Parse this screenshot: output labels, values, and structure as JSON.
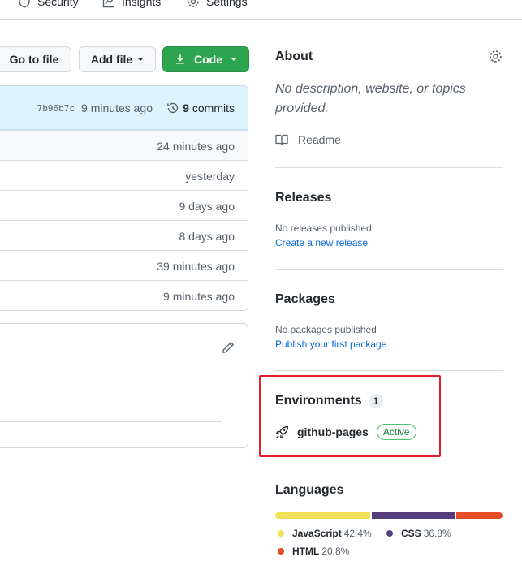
{
  "nav": {
    "security": "Security",
    "insights": "Insights",
    "settings": "Settings"
  },
  "toolbar": {
    "go_to_file": "Go to file",
    "add_file": "Add file",
    "code": "Code"
  },
  "commit": {
    "sha": "7b96b7c",
    "ago": "9 minutes ago",
    "count": "9",
    "commits_label": "commits"
  },
  "file_rows": [
    {
      "time": "24 minutes ago"
    },
    {
      "time": "yesterday"
    },
    {
      "time": "9 days ago"
    },
    {
      "time": "8 days ago"
    },
    {
      "time": "39 minutes ago"
    },
    {
      "time": "9 minutes ago"
    }
  ],
  "about": {
    "title": "About",
    "description": "No description, website, or topics provided.",
    "readme": "Readme"
  },
  "releases": {
    "title": "Releases",
    "none": "No releases published",
    "create": "Create a new release"
  },
  "packages": {
    "title": "Packages",
    "none": "No packages published",
    "publish": "Publish your first package"
  },
  "environments": {
    "title": "Environments",
    "count": "1",
    "name": "github-pages",
    "status": "Active"
  },
  "languages": {
    "title": "Languages",
    "items": [
      {
        "name": "JavaScript",
        "percent": "42.4%",
        "value": 42.4,
        "color": "#f1e05a"
      },
      {
        "name": "CSS",
        "percent": "36.8%",
        "value": 36.8,
        "color": "#563d7c"
      },
      {
        "name": "HTML",
        "percent": "20.8%",
        "value": 20.8,
        "color": "#e34c26"
      }
    ]
  }
}
